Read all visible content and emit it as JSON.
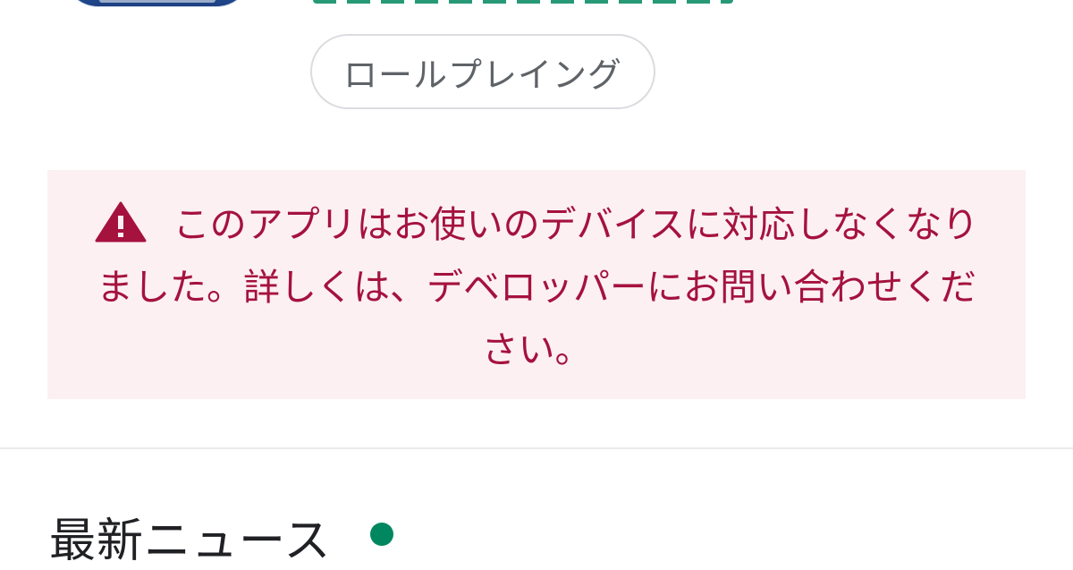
{
  "app_header": {
    "icon": "app-icon"
  },
  "genre_chip": {
    "label": "ロールプレイング"
  },
  "warning": {
    "icon": "warning-triangle-icon",
    "message": "このアプリはお使いのデバイスに対応しなくなりました。詳しくは、デベロッパーにお問い合わせください。",
    "text_color": "#a5123e",
    "background_color": "#fcf0f3"
  },
  "news": {
    "title": "最新ニュース",
    "indicator_color": "#01875f"
  }
}
